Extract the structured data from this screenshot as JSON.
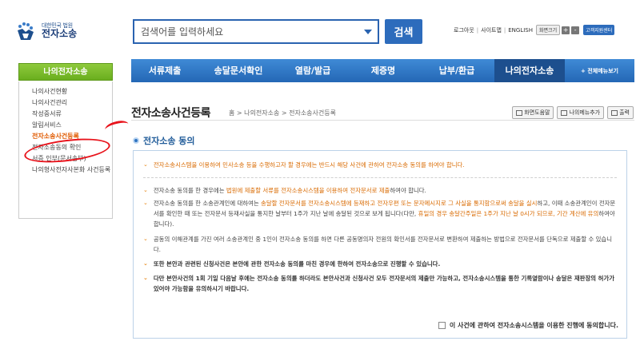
{
  "logo": {
    "small": "대한민국 법원",
    "big": "전자소송"
  },
  "search": {
    "placeholder": "검색어를 입력하세요",
    "button": "검색"
  },
  "util": {
    "logout": "로그아웃",
    "sitemap": "사이트맵",
    "english": "ENGLISH",
    "font_size": "화면크기",
    "plus": "+",
    "minus": "-",
    "center": "고객지원센터"
  },
  "nav": {
    "items": [
      "서류제출",
      "송달문서확인",
      "열람/발급",
      "제증명",
      "납부/환급",
      "나의전자소송"
    ],
    "all": "+ 전체메뉴보기"
  },
  "sidebar": {
    "title": "나의전자소송",
    "items": [
      "나의사건현황",
      "나의사건관리",
      "작성중서류",
      "알림서비스",
      "전자소송사건등록",
      "전자소송동의 확인",
      "서증 인부(문서송부)",
      "나의형사전자사본화 사건등록"
    ]
  },
  "page": {
    "title": "전자소송사건등록",
    "breadcrumb": "홈 > 나의전자소송 > 전자소송사건등록",
    "tools": [
      "화면도움말",
      "나의메뉴추가",
      "출력"
    ]
  },
  "section": {
    "title": "전자소송 동의"
  },
  "content": {
    "p1": "전자소송시스템을 이용하여 민사소송 등을 수행하고자 할 경우에는 반드시 해당 사건에 관하여 전자소송 동의를 하여야 합니다.",
    "p2a": "전자소송 동의를 한 경우에는 ",
    "p2b": "법원에 제출할 서류를 전자소송시스템을 이용하여 전자문서로 제출",
    "p2c": "하여야 합니다.",
    "p3a": "전자소송 동의를 한 소송관계인에 대하여는 ",
    "p3b": "송달할 전자문서를 전자소송시스템에 등재하고 전자우편 또는 문자메시지로 그 사실을 통지함으로써 송달을 실시",
    "p3c": "하고, 이때 소송관계인이 전자문서를 확인한 때 또는 전자문서 등재사실을 통지한 날부터 1주가 지난 날에 송달된 것으로 보게 됩니다(다만, ",
    "p3d": "휴일의 경우 송달간주일은 1주가 지난 날 0시가 되므로, 기간 계산에 유의",
    "p3e": "하여야 합니다).",
    "p4": "공동의 이해관계를 가진 여러 소송관계인 중 1인이 전자소송 동의를 하면 다른 공동명의자 전원의 확인서를 전자문서로 변환하여 제출하는 방법으로 전자문서를 단독으로 제출할 수 있습니다.",
    "p5": "또한 본안과 관련된 신청사건은 본안에 관한 전자소송 동의를 마친 경우에 한하여 전자소송으로 진행할 수 있습니다.",
    "p6": "다만 본안사건의 1회 기일 다음날 후에는 전자소송 동의를 하더라도 본안사건과 신청사건 모두 전자문서의 제출만 가능하고, 전자소송시스템을 통한 기록열람이나 송달은 재판장의 허가가 있어야 가능함을 유의하시기 바랍니다.",
    "agree": "이 사건에 관하여 전자소송시스템을 이용한 진행에 동의합니다."
  }
}
